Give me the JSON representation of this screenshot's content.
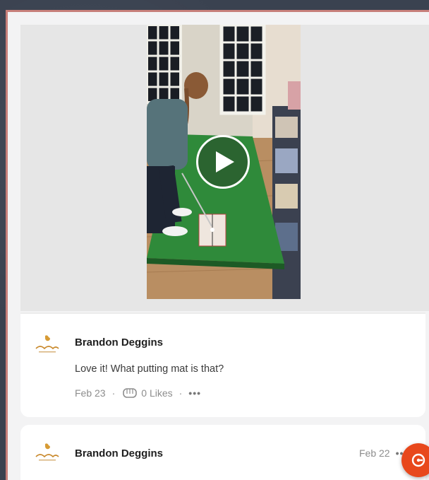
{
  "post": {
    "video": {
      "state": "paused"
    }
  },
  "comments": [
    {
      "author": "Brandon Deggins",
      "text": "Love it! What putting mat is that?",
      "date": "Feb 23",
      "likes": "0 Likes",
      "more": "•••"
    },
    {
      "author": "Brandon Deggins",
      "date": "Feb 22",
      "more": "••"
    }
  ],
  "colors": {
    "accent": "#e8481c",
    "putting_green": "#2f8a3a",
    "frame_border": "#c77f7a"
  },
  "icons": {
    "play": "play-icon",
    "likes": "fist-bump-icon",
    "fab": "chat-launcher-icon",
    "avatar": "brand-logo-icon"
  }
}
